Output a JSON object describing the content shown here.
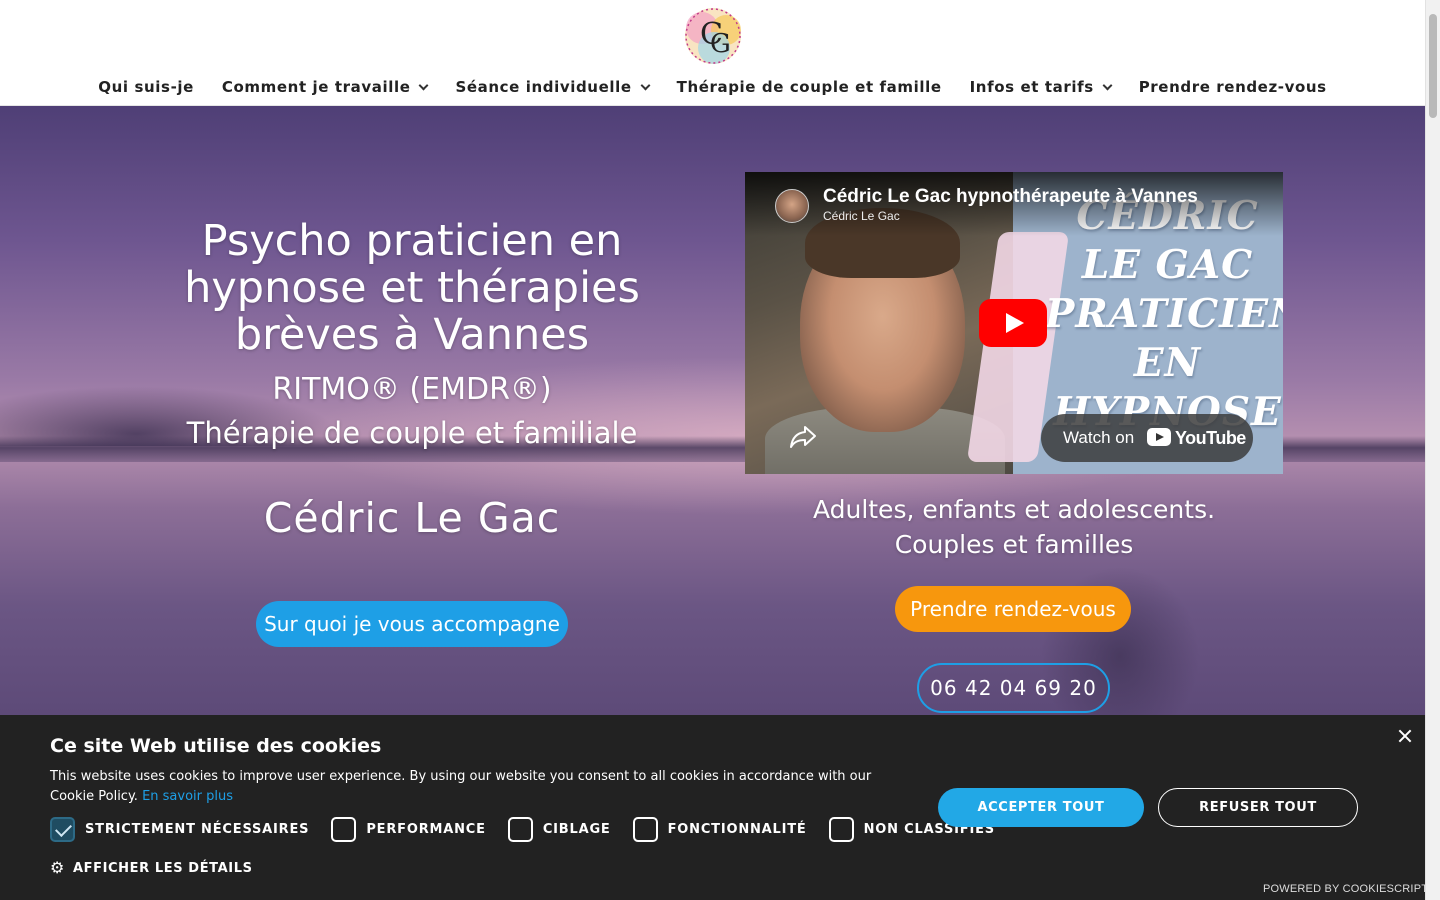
{
  "nav": {
    "items": [
      {
        "label": "Qui suis-je",
        "dropdown": false
      },
      {
        "label": "Comment je travaille",
        "dropdown": true
      },
      {
        "label": "Séance individuelle",
        "dropdown": true
      },
      {
        "label": "Thérapie de couple et famille",
        "dropdown": false
      },
      {
        "label": "Infos et tarifs",
        "dropdown": true
      },
      {
        "label": "Prendre rendez-vous",
        "dropdown": false
      }
    ]
  },
  "hero": {
    "title": "Psycho praticien en hypnose et thérapies brèves à Vannes",
    "subtitle_1": "RITMO® (EMDR®)",
    "subtitle_2": "Thérapie de couple et familiale",
    "name": "Cédric Le Gac",
    "cta_label": "Sur quoi je vous accompagne",
    "audience_line_1": "Adultes, enfants et adolescents.",
    "audience_line_2": "Couples et familles",
    "appointment_label": "Prendre rendez-vous",
    "phone": "06 42 04 69 20"
  },
  "video": {
    "title": "Cédric Le Gac hypnothérapeute à Vannes",
    "channel": "Cédric Le Gac",
    "thumbnail_text": "CÉDRIC\nLE GAC\nPRATICIEN\nEN\nHYPNOSE",
    "watch_on": "Watch on",
    "platform": "YouTube"
  },
  "cookie_banner": {
    "title": "Ce site Web utilise des cookies",
    "text": "This website uses cookies to improve user experience. By using our website you consent to all cookies in accordance with our Cookie Policy.",
    "link_label": "En savoir plus",
    "categories": [
      {
        "label": "STRICTEMENT NÉCESSAIRES",
        "checked": true
      },
      {
        "label": "PERFORMANCE",
        "checked": false
      },
      {
        "label": "CIBLAGE",
        "checked": false
      },
      {
        "label": "FONCTIONNALITÉ",
        "checked": false
      },
      {
        "label": "NON CLASSIFIÉS",
        "checked": false
      }
    ],
    "details_label": "AFFICHER LES DÉTAILS",
    "accept_label": "ACCEPTER TOUT",
    "refuse_label": "REFUSER TOUT",
    "powered_by": "POWERED BY COOKIESCRIPT"
  },
  "colors": {
    "accent_blue": "#1e9fe6",
    "accent_orange": "#f7970d",
    "banner_bg": "#222222",
    "youtube_red": "#ff0000"
  },
  "icons": [
    "site-logo",
    "chevron-down-icon",
    "play-icon",
    "share-icon",
    "youtube-logo-icon",
    "close-icon",
    "gear-icon",
    "checkmark-icon"
  ]
}
